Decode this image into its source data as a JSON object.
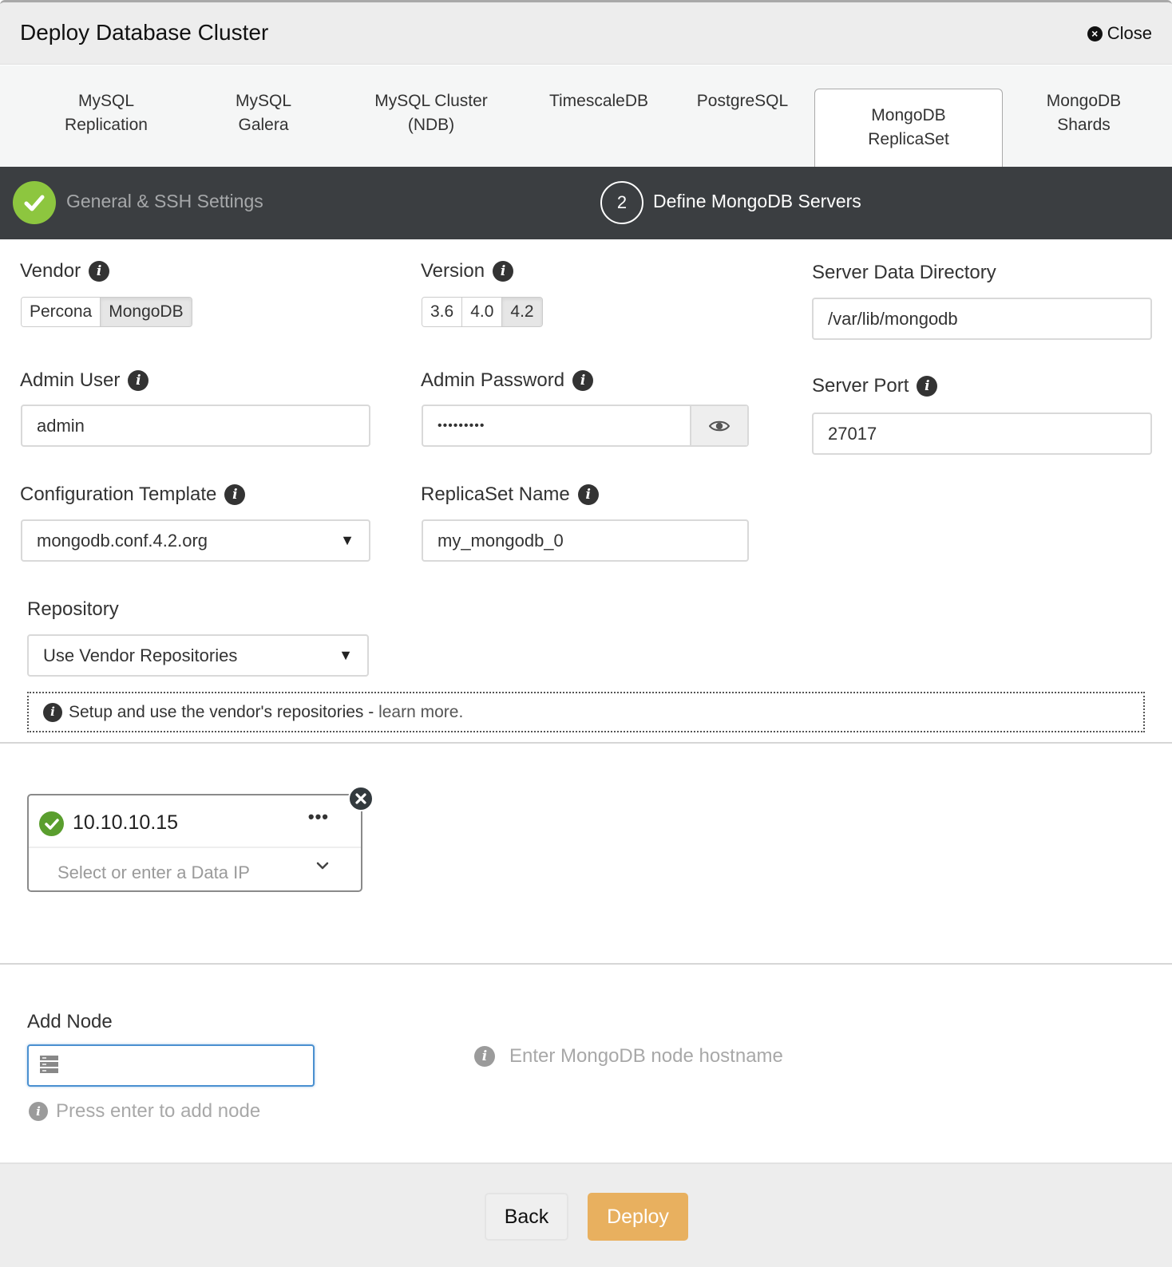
{
  "header": {
    "title": "Deploy Database Cluster",
    "close_label": "Close"
  },
  "tabs": [
    {
      "line1": "MySQL",
      "line2": "Replication",
      "active": false
    },
    {
      "line1": "MySQL",
      "line2": "Galera",
      "active": false
    },
    {
      "line1": "MySQL Cluster",
      "line2": "(NDB)",
      "active": false
    },
    {
      "line1": "TimescaleDB",
      "line2": "",
      "active": false
    },
    {
      "line1": "PostgreSQL",
      "line2": "",
      "active": false
    },
    {
      "line1": "MongoDB",
      "line2": "ReplicaSet",
      "active": true
    },
    {
      "line1": "MongoDB",
      "line2": "Shards",
      "active": false
    }
  ],
  "stepper": {
    "step1": {
      "label": "General & SSH Settings",
      "status": "complete"
    },
    "step2": {
      "number": "2",
      "label": "Define MongoDB Servers",
      "status": "current"
    }
  },
  "form": {
    "vendor": {
      "label": "Vendor",
      "options": [
        "Percona",
        "MongoDB"
      ],
      "selected": "MongoDB"
    },
    "version": {
      "label": "Version",
      "options": [
        "3.6",
        "4.0",
        "4.2"
      ],
      "selected": "4.2"
    },
    "data_dir": {
      "label": "Server Data Directory",
      "value": "/var/lib/mongodb"
    },
    "admin_user": {
      "label": "Admin User",
      "value": "admin"
    },
    "admin_password": {
      "label": "Admin Password",
      "value": "•••••••••"
    },
    "server_port": {
      "label": "Server Port",
      "value": "27017"
    },
    "config_template": {
      "label": "Configuration Template",
      "value": "mongodb.conf.4.2.org"
    },
    "replicaset_name": {
      "label": "ReplicaSet Name",
      "value": "my_mongodb_0"
    },
    "repository": {
      "label": "Repository",
      "value": "Use Vendor Repositories",
      "notice_text": "Setup and use the vendor's repositories - ",
      "notice_link": "learn more."
    }
  },
  "nodes": [
    {
      "ip": "10.10.10.15",
      "status": "ok",
      "data_ip_placeholder": "Select or enter a Data IP",
      "more_label": "•••"
    }
  ],
  "add_node": {
    "label": "Add Node",
    "value": "",
    "hint": "Press enter to add node",
    "side_hint": "Enter MongoDB node hostname"
  },
  "footer": {
    "back_label": "Back",
    "deploy_label": "Deploy",
    "deploy_color": "#e8b05f"
  },
  "colors": {
    "step_complete": "#8dc63f",
    "node_ok": "#5a9e2e",
    "stepper_bg": "#3b3e41"
  }
}
